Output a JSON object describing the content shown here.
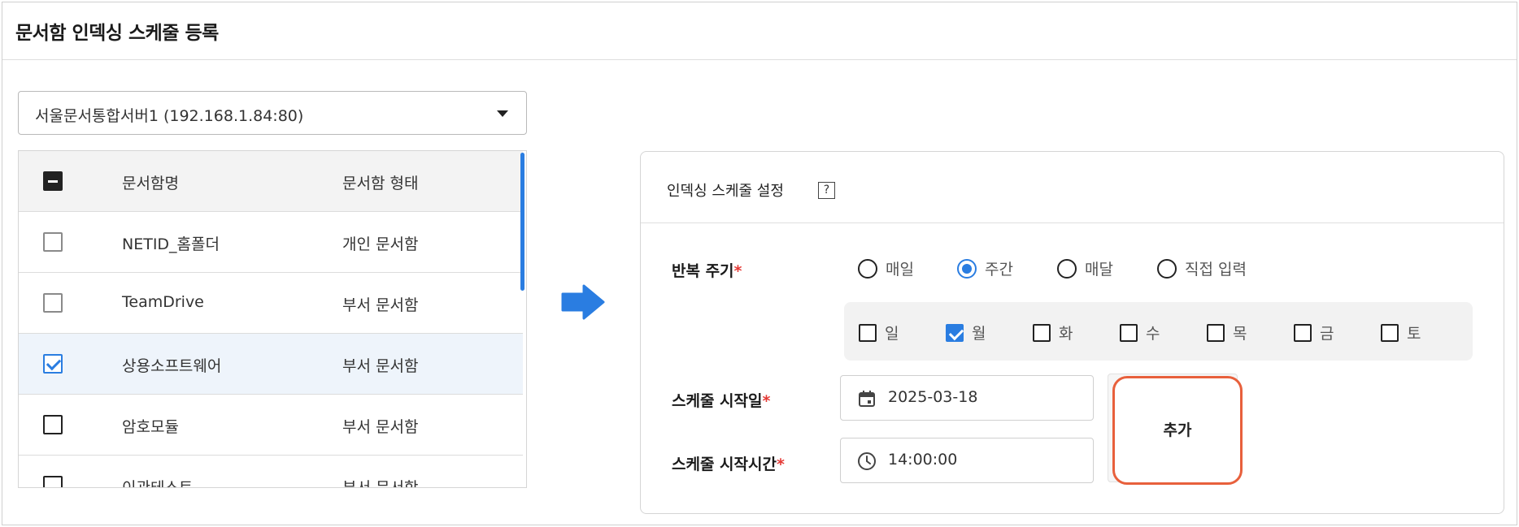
{
  "page": {
    "title": "문서함 인덱싱 스케줄 등록"
  },
  "server": {
    "selected": "서울문서통합서버1 (192.168.1.84:80)"
  },
  "table": {
    "headers": {
      "name": "문서함명",
      "type": "문서함 형태"
    },
    "rows": [
      {
        "name": "NETID_홈폴더",
        "type": "개인 문서함",
        "checked": false
      },
      {
        "name": "TeamDrive",
        "type": "부서 문서함",
        "checked": false
      },
      {
        "name": "상용소프트웨어",
        "type": "부서 문서함",
        "checked": true
      },
      {
        "name": "암호모듈",
        "type": "부서 문서함",
        "checked": false
      },
      {
        "name": "이관테스트",
        "type": "부서 문서함",
        "checked": false
      }
    ]
  },
  "settings": {
    "title": "인덱싱 스케줄 설정",
    "help": "?",
    "repeat": {
      "label": "반복 주기",
      "required_mark": "*",
      "options": [
        "매일",
        "주간",
        "매달",
        "직접 입력"
      ],
      "selected": "주간"
    },
    "days": [
      {
        "label": "일",
        "checked": false
      },
      {
        "label": "월",
        "checked": true
      },
      {
        "label": "화",
        "checked": false
      },
      {
        "label": "수",
        "checked": false
      },
      {
        "label": "목",
        "checked": false
      },
      {
        "label": "금",
        "checked": false
      },
      {
        "label": "토",
        "checked": false
      }
    ],
    "start_date": {
      "label": "스케줄 시작일",
      "required_mark": "*",
      "value": "2025-03-18",
      "icon": "calendar-icon"
    },
    "start_time": {
      "label": "스케줄 시작시간",
      "required_mark": "*",
      "value": "14:00:00",
      "icon": "clock-icon"
    },
    "add_button": "추가"
  },
  "colors": {
    "accent": "#2a7de1",
    "required": "#e53935",
    "highlight": "#e8603c"
  }
}
